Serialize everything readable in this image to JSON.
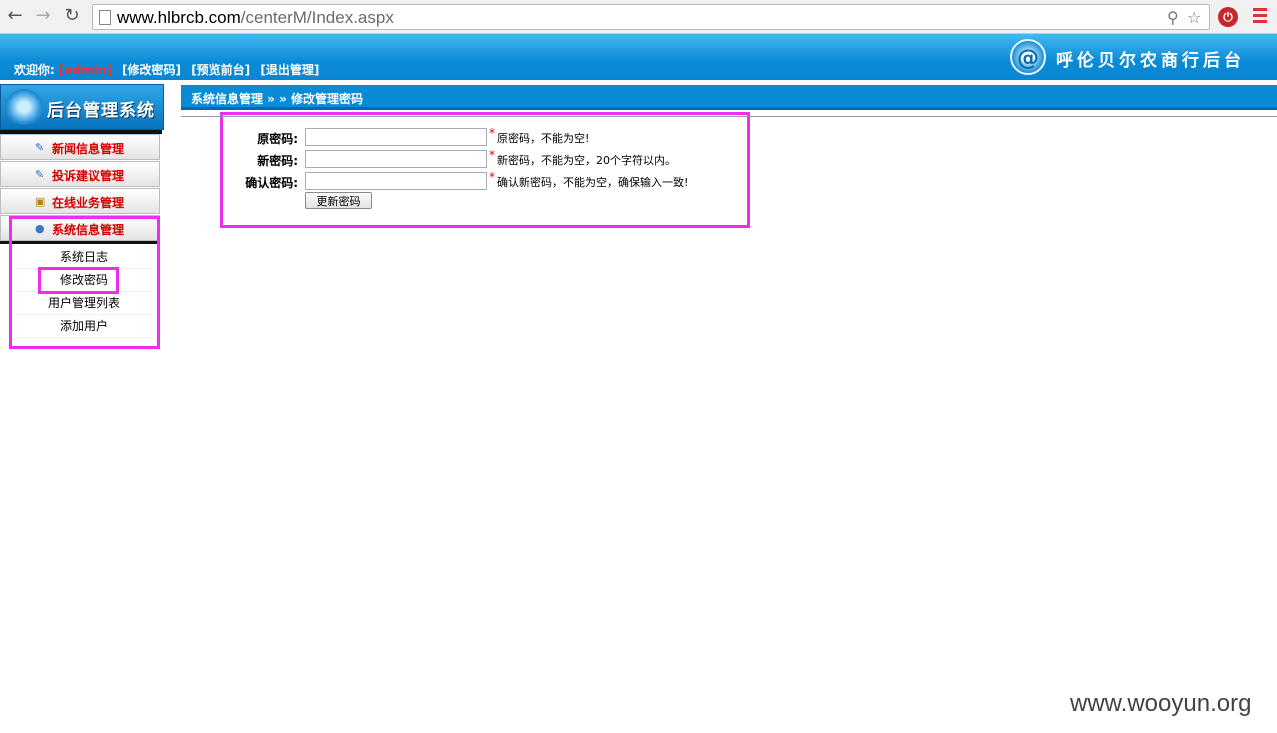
{
  "browser": {
    "url_host": "www.hlbrcb.com",
    "url_path": "/centerM/Index.aspx",
    "back_icon": "arrow-left-icon",
    "forward_icon": "arrow-right-icon",
    "reload_icon": "reload-icon"
  },
  "header": {
    "welcome_label": "欢迎你:",
    "username": "[admin]",
    "links": [
      "[修改密码]",
      "[预览前台]",
      "[退出管理]"
    ],
    "brand_text": "呼伦贝尔农商行后台",
    "brand_logo_glyph": "@"
  },
  "sidebar": {
    "system_title": "后台管理系统",
    "menus": [
      {
        "label": "新闻信息管理",
        "icon": "news-icon"
      },
      {
        "label": "投诉建议管理",
        "icon": "feedback-icon"
      },
      {
        "label": "在线业务管理",
        "icon": "business-icon"
      },
      {
        "label": "系统信息管理",
        "icon": "user-icon"
      }
    ],
    "sub_items": [
      "系统日志",
      "修改密码",
      "用户管理列表",
      "添加用户"
    ]
  },
  "breadcrumb": "系统信息管理 » » 修改管理密码",
  "form": {
    "fields": [
      {
        "label": "原密码:",
        "value": "",
        "hint": "原密码，不能为空!"
      },
      {
        "label": "新密码:",
        "value": "",
        "hint": "新密码，不能为空，20个字符以内。"
      },
      {
        "label": "确认密码:",
        "value": "",
        "hint": "确认新密码，不能为空，确保输入一致!"
      }
    ],
    "required_mark": "*",
    "submit_label": "更新密码"
  },
  "watermark": "www.wooyun.org",
  "colors": {
    "accent": "#0a8bd6",
    "menu_text": "#d60000",
    "highlight": "#f02cf0"
  }
}
